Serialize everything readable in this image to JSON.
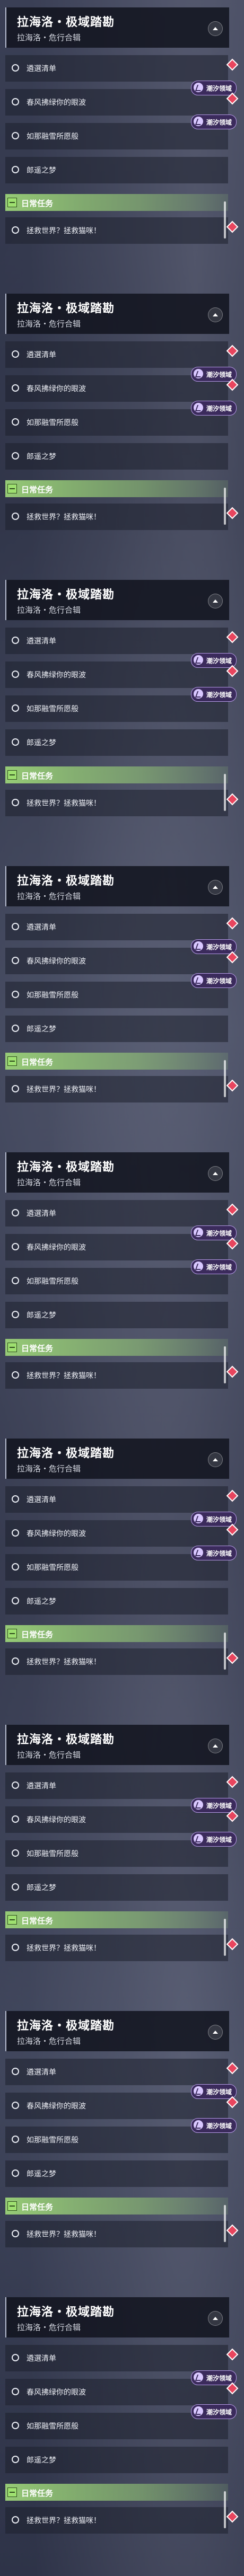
{
  "panels": [
    {
      "title": "拉海洛・极域踏勘",
      "subtitle": "拉海洛・危行合辑",
      "tasks": [
        "遴選清单",
        "春风拂绿你的眼波",
        "如那融雪所愿般",
        "郎遥之梦"
      ],
      "badge_label": "潮汐领域",
      "daily_label": "日常任务",
      "daily_task": "拯救世界？拯救猫咪！"
    }
  ]
}
